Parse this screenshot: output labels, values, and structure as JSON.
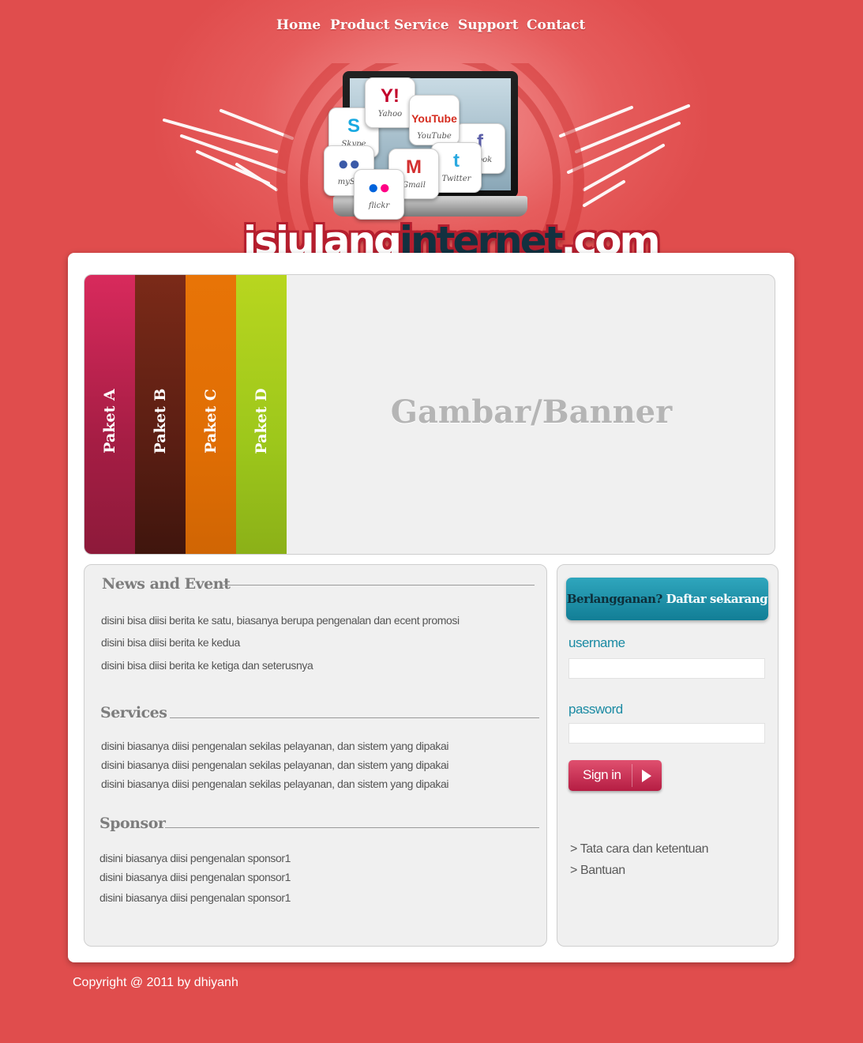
{
  "nav": [
    "Home",
    "Product",
    "Service",
    "Support",
    "Contact"
  ],
  "header": {
    "social_tiles": [
      "Yahoo",
      "YouTube",
      "Skype",
      "Facebook",
      "MySpace",
      "Gmail",
      "Twitter",
      "flickr"
    ],
    "tile_captions": {
      "yahoo": "Yahoo",
      "youtube": "YouTube",
      "skype": "Skype",
      "facebook": "ebook",
      "myspace": "mySp",
      "gmail": "Gmail",
      "twitter": "Twitter",
      "flickr": "flickr"
    },
    "logo_part1": "isiulang",
    "logo_part2": "internet",
    "logo_part3": ".com"
  },
  "slider": {
    "tabs": [
      {
        "label": "Paket A",
        "color": "#c02252"
      },
      {
        "label": "Paket B",
        "color": "#652014"
      },
      {
        "label": "Paket C",
        "color": "#e06e04"
      },
      {
        "label": "Paket D",
        "color": "#9dc71b"
      }
    ],
    "banner_text": "Gambar/Banner"
  },
  "news": {
    "title": "News and Event",
    "items": [
      "disini bisa diisi berita ke satu, biasanya berupa pengenalan dan ecent promosi",
      "disini bisa diisi berita ke kedua",
      "disini bisa diisi berita ke ketiga dan seterusnya"
    ]
  },
  "services": {
    "title": "Services",
    "items": [
      "disini biasanya diisi pengenalan sekilas pelayanan, dan sistem yang dipakai",
      "disini biasanya diisi pengenalan sekilas pelayanan, dan sistem yang dipakai",
      "disini biasanya diisi pengenalan sekilas pelayanan, dan sistem yang dipakai"
    ]
  },
  "sponsor": {
    "title": "Sponsor",
    "items": [
      "disini biasanya diisi pengenalan sponsor1",
      "disini biasanya diisi pengenalan sponsor1",
      "disini biasanya diisi pengenalan sponsor1"
    ]
  },
  "login": {
    "cta_question": "Berlangganan?",
    "cta_action": "Daftar sekarang",
    "username_label": "username",
    "username_value": "",
    "password_label": "password",
    "password_value": "",
    "signin_label": "Sign in",
    "links": [
      "> Tata cara dan ketentuan",
      "> Bantuan"
    ]
  },
  "footer": {
    "copyright": "Copyright @ 2011 by dhiyanh"
  },
  "colors": {
    "background": "#e04d4d",
    "accent_teal": "#1a8aa3",
    "signin": "#c8284f"
  }
}
